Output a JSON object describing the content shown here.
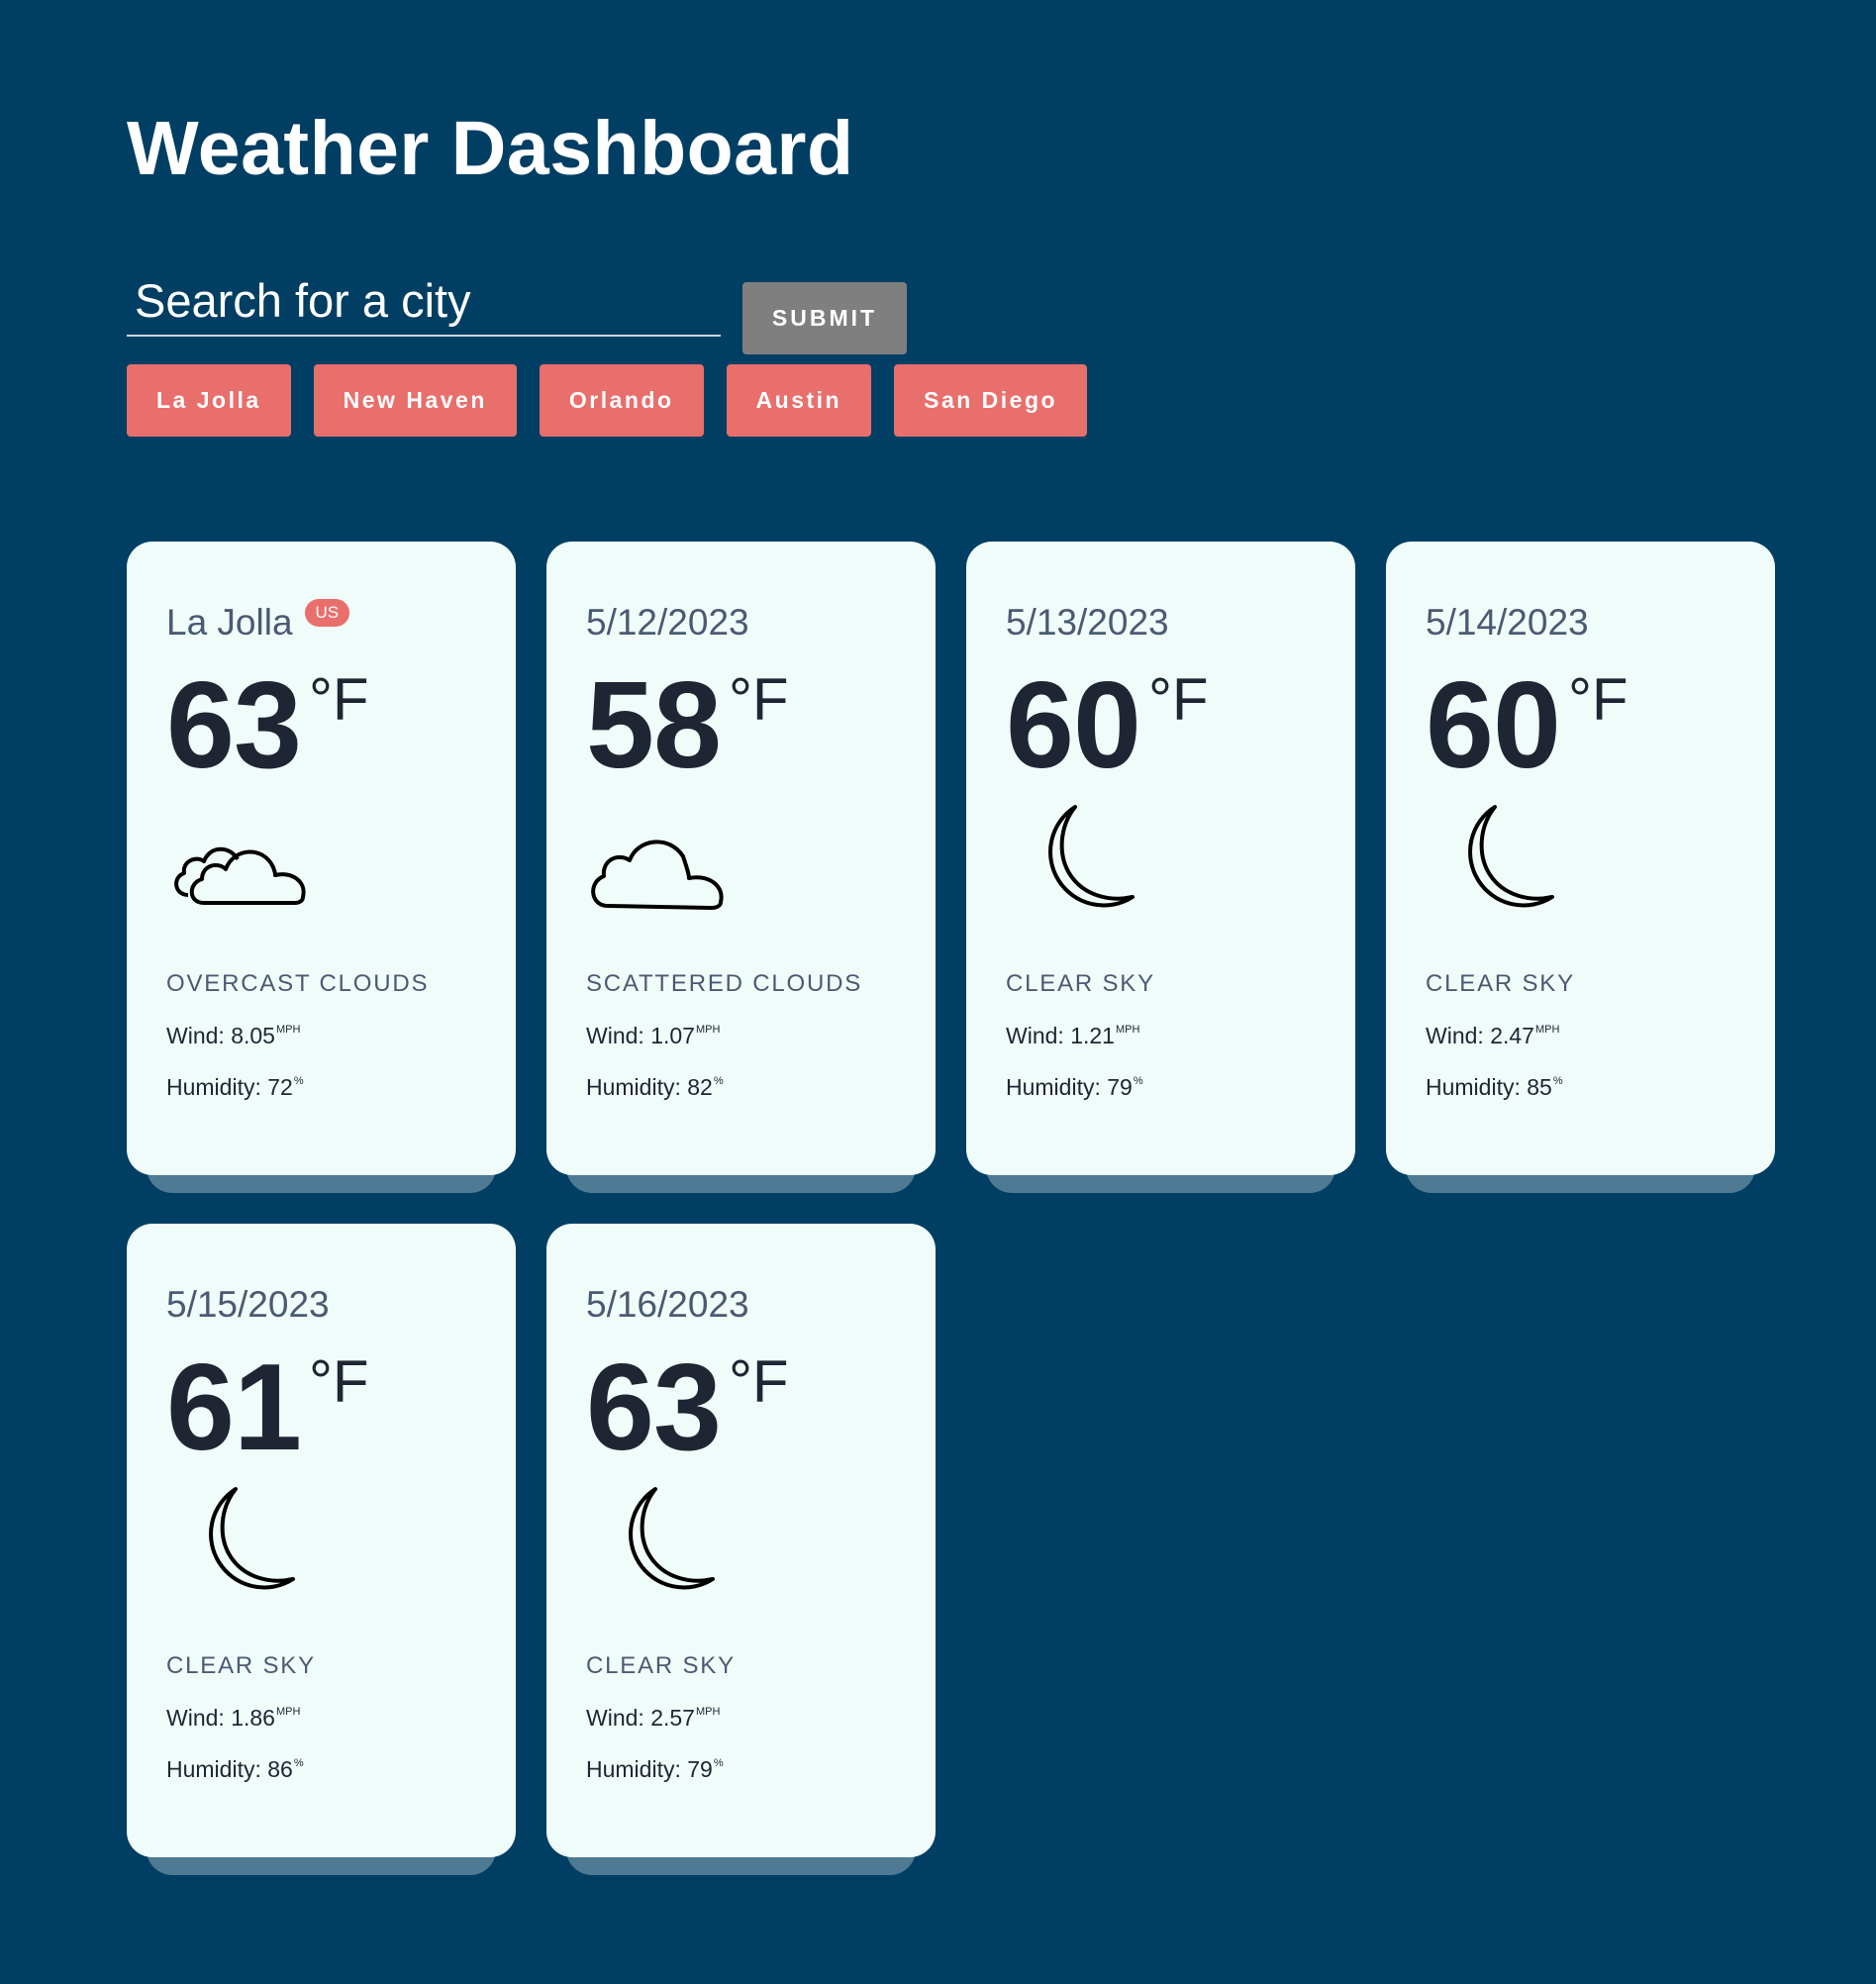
{
  "app": {
    "title": "Weather Dashboard"
  },
  "search": {
    "placeholder": "Search for a city",
    "submit_label": "SUBMIT"
  },
  "history": [
    "La Jolla",
    "New Haven",
    "Orlando",
    "Austin",
    "San Diego"
  ],
  "colors": {
    "background": "#003f63",
    "accent": "#e86f6c",
    "submit": "#7f7f7f",
    "card": "#f0fcf9"
  },
  "cards": [
    {
      "heading": "La Jolla",
      "badge": "US",
      "temp": "63",
      "unit": "°F",
      "icon": "overcast-clouds-icon",
      "condition": "OVERCAST CLOUDS",
      "wind_label": "Wind: ",
      "wind": "8.05",
      "wind_unit": "MPH",
      "humidity_label": "Humidity: ",
      "humidity": "72",
      "humidity_unit": "%"
    },
    {
      "heading": "5/12/2023",
      "temp": "58",
      "unit": "°F",
      "icon": "scattered-clouds-icon",
      "condition": "SCATTERED CLOUDS",
      "wind_label": "Wind: ",
      "wind": "1.07",
      "wind_unit": "MPH",
      "humidity_label": "Humidity: ",
      "humidity": "82",
      "humidity_unit": "%"
    },
    {
      "heading": "5/13/2023",
      "temp": "60",
      "unit": "°F",
      "icon": "moon-icon",
      "condition": "CLEAR SKY",
      "wind_label": "Wind: ",
      "wind": "1.21",
      "wind_unit": "MPH",
      "humidity_label": "Humidity: ",
      "humidity": "79",
      "humidity_unit": "%"
    },
    {
      "heading": "5/14/2023",
      "temp": "60",
      "unit": "°F",
      "icon": "moon-icon",
      "condition": "CLEAR SKY",
      "wind_label": "Wind: ",
      "wind": "2.47",
      "wind_unit": "MPH",
      "humidity_label": "Humidity: ",
      "humidity": "85",
      "humidity_unit": "%"
    },
    {
      "heading": "5/15/2023",
      "temp": "61",
      "unit": "°F",
      "icon": "moon-icon",
      "condition": "CLEAR SKY",
      "wind_label": "Wind: ",
      "wind": "1.86",
      "wind_unit": "MPH",
      "humidity_label": "Humidity: ",
      "humidity": "86",
      "humidity_unit": "%"
    },
    {
      "heading": "5/16/2023",
      "temp": "63",
      "unit": "°F",
      "icon": "moon-icon",
      "condition": "CLEAR SKY",
      "wind_label": "Wind: ",
      "wind": "2.57",
      "wind_unit": "MPH",
      "humidity_label": "Humidity: ",
      "humidity": "79",
      "humidity_unit": "%"
    }
  ]
}
